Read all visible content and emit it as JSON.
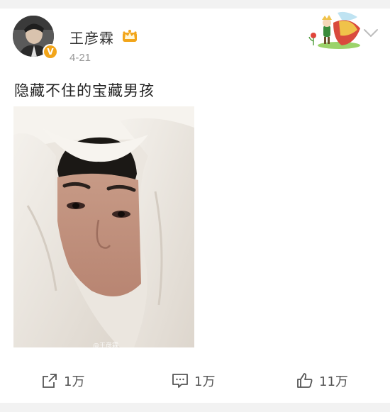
{
  "post": {
    "author": "王彦霖",
    "time": "4-21",
    "text": "隐藏不住的宝藏男孩",
    "verified_badge": "V",
    "photo_watermark": "@王彦霖"
  },
  "actions": {
    "repost_count": "1万",
    "comment_count": "1万",
    "like_count": "11万"
  },
  "icons": {
    "repost": "repost-icon",
    "comment": "comment-icon",
    "like": "thumbs-up-icon",
    "menu": "chevron-down-icon",
    "member": "crown-icon"
  },
  "colors": {
    "badge": "#f2a51a",
    "crown": "#f2a51a",
    "text": "#222222",
    "muted": "#999999"
  }
}
